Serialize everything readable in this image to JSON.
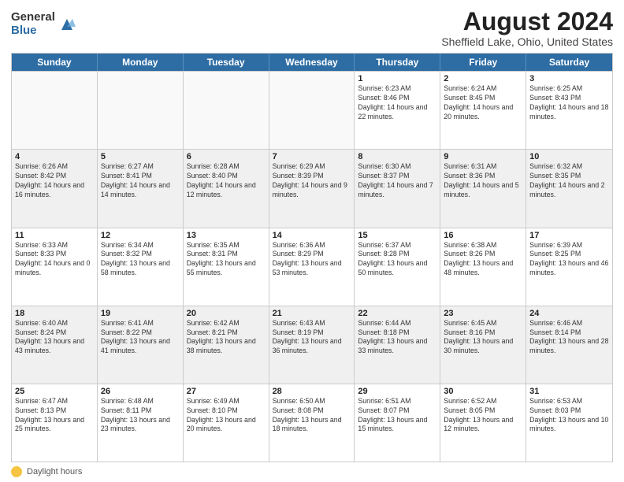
{
  "logo": {
    "general": "General",
    "blue": "Blue"
  },
  "title": "August 2024",
  "location": "Sheffield Lake, Ohio, United States",
  "days_header": [
    "Sunday",
    "Monday",
    "Tuesday",
    "Wednesday",
    "Thursday",
    "Friday",
    "Saturday"
  ],
  "footer": {
    "label": "Daylight hours"
  },
  "weeks": [
    [
      {
        "day": "",
        "sunrise": "",
        "sunset": "",
        "daylight": "",
        "empty": true
      },
      {
        "day": "",
        "sunrise": "",
        "sunset": "",
        "daylight": "",
        "empty": true
      },
      {
        "day": "",
        "sunrise": "",
        "sunset": "",
        "daylight": "",
        "empty": true
      },
      {
        "day": "",
        "sunrise": "",
        "sunset": "",
        "daylight": "",
        "empty": true
      },
      {
        "day": "1",
        "sunrise": "Sunrise: 6:23 AM",
        "sunset": "Sunset: 8:46 PM",
        "daylight": "Daylight: 14 hours and 22 minutes.",
        "empty": false
      },
      {
        "day": "2",
        "sunrise": "Sunrise: 6:24 AM",
        "sunset": "Sunset: 8:45 PM",
        "daylight": "Daylight: 14 hours and 20 minutes.",
        "empty": false
      },
      {
        "day": "3",
        "sunrise": "Sunrise: 6:25 AM",
        "sunset": "Sunset: 8:43 PM",
        "daylight": "Daylight: 14 hours and 18 minutes.",
        "empty": false
      }
    ],
    [
      {
        "day": "4",
        "sunrise": "Sunrise: 6:26 AM",
        "sunset": "Sunset: 8:42 PM",
        "daylight": "Daylight: 14 hours and 16 minutes.",
        "empty": false
      },
      {
        "day": "5",
        "sunrise": "Sunrise: 6:27 AM",
        "sunset": "Sunset: 8:41 PM",
        "daylight": "Daylight: 14 hours and 14 minutes.",
        "empty": false
      },
      {
        "day": "6",
        "sunrise": "Sunrise: 6:28 AM",
        "sunset": "Sunset: 8:40 PM",
        "daylight": "Daylight: 14 hours and 12 minutes.",
        "empty": false
      },
      {
        "day": "7",
        "sunrise": "Sunrise: 6:29 AM",
        "sunset": "Sunset: 8:39 PM",
        "daylight": "Daylight: 14 hours and 9 minutes.",
        "empty": false
      },
      {
        "day": "8",
        "sunrise": "Sunrise: 6:30 AM",
        "sunset": "Sunset: 8:37 PM",
        "daylight": "Daylight: 14 hours and 7 minutes.",
        "empty": false
      },
      {
        "day": "9",
        "sunrise": "Sunrise: 6:31 AM",
        "sunset": "Sunset: 8:36 PM",
        "daylight": "Daylight: 14 hours and 5 minutes.",
        "empty": false
      },
      {
        "day": "10",
        "sunrise": "Sunrise: 6:32 AM",
        "sunset": "Sunset: 8:35 PM",
        "daylight": "Daylight: 14 hours and 2 minutes.",
        "empty": false
      }
    ],
    [
      {
        "day": "11",
        "sunrise": "Sunrise: 6:33 AM",
        "sunset": "Sunset: 8:33 PM",
        "daylight": "Daylight: 14 hours and 0 minutes.",
        "empty": false
      },
      {
        "day": "12",
        "sunrise": "Sunrise: 6:34 AM",
        "sunset": "Sunset: 8:32 PM",
        "daylight": "Daylight: 13 hours and 58 minutes.",
        "empty": false
      },
      {
        "day": "13",
        "sunrise": "Sunrise: 6:35 AM",
        "sunset": "Sunset: 8:31 PM",
        "daylight": "Daylight: 13 hours and 55 minutes.",
        "empty": false
      },
      {
        "day": "14",
        "sunrise": "Sunrise: 6:36 AM",
        "sunset": "Sunset: 8:29 PM",
        "daylight": "Daylight: 13 hours and 53 minutes.",
        "empty": false
      },
      {
        "day": "15",
        "sunrise": "Sunrise: 6:37 AM",
        "sunset": "Sunset: 8:28 PM",
        "daylight": "Daylight: 13 hours and 50 minutes.",
        "empty": false
      },
      {
        "day": "16",
        "sunrise": "Sunrise: 6:38 AM",
        "sunset": "Sunset: 8:26 PM",
        "daylight": "Daylight: 13 hours and 48 minutes.",
        "empty": false
      },
      {
        "day": "17",
        "sunrise": "Sunrise: 6:39 AM",
        "sunset": "Sunset: 8:25 PM",
        "daylight": "Daylight: 13 hours and 46 minutes.",
        "empty": false
      }
    ],
    [
      {
        "day": "18",
        "sunrise": "Sunrise: 6:40 AM",
        "sunset": "Sunset: 8:24 PM",
        "daylight": "Daylight: 13 hours and 43 minutes.",
        "empty": false
      },
      {
        "day": "19",
        "sunrise": "Sunrise: 6:41 AM",
        "sunset": "Sunset: 8:22 PM",
        "daylight": "Daylight: 13 hours and 41 minutes.",
        "empty": false
      },
      {
        "day": "20",
        "sunrise": "Sunrise: 6:42 AM",
        "sunset": "Sunset: 8:21 PM",
        "daylight": "Daylight: 13 hours and 38 minutes.",
        "empty": false
      },
      {
        "day": "21",
        "sunrise": "Sunrise: 6:43 AM",
        "sunset": "Sunset: 8:19 PM",
        "daylight": "Daylight: 13 hours and 36 minutes.",
        "empty": false
      },
      {
        "day": "22",
        "sunrise": "Sunrise: 6:44 AM",
        "sunset": "Sunset: 8:18 PM",
        "daylight": "Daylight: 13 hours and 33 minutes.",
        "empty": false
      },
      {
        "day": "23",
        "sunrise": "Sunrise: 6:45 AM",
        "sunset": "Sunset: 8:16 PM",
        "daylight": "Daylight: 13 hours and 30 minutes.",
        "empty": false
      },
      {
        "day": "24",
        "sunrise": "Sunrise: 6:46 AM",
        "sunset": "Sunset: 8:14 PM",
        "daylight": "Daylight: 13 hours and 28 minutes.",
        "empty": false
      }
    ],
    [
      {
        "day": "25",
        "sunrise": "Sunrise: 6:47 AM",
        "sunset": "Sunset: 8:13 PM",
        "daylight": "Daylight: 13 hours and 25 minutes.",
        "empty": false
      },
      {
        "day": "26",
        "sunrise": "Sunrise: 6:48 AM",
        "sunset": "Sunset: 8:11 PM",
        "daylight": "Daylight: 13 hours and 23 minutes.",
        "empty": false
      },
      {
        "day": "27",
        "sunrise": "Sunrise: 6:49 AM",
        "sunset": "Sunset: 8:10 PM",
        "daylight": "Daylight: 13 hours and 20 minutes.",
        "empty": false
      },
      {
        "day": "28",
        "sunrise": "Sunrise: 6:50 AM",
        "sunset": "Sunset: 8:08 PM",
        "daylight": "Daylight: 13 hours and 18 minutes.",
        "empty": false
      },
      {
        "day": "29",
        "sunrise": "Sunrise: 6:51 AM",
        "sunset": "Sunset: 8:07 PM",
        "daylight": "Daylight: 13 hours and 15 minutes.",
        "empty": false
      },
      {
        "day": "30",
        "sunrise": "Sunrise: 6:52 AM",
        "sunset": "Sunset: 8:05 PM",
        "daylight": "Daylight: 13 hours and 12 minutes.",
        "empty": false
      },
      {
        "day": "31",
        "sunrise": "Sunrise: 6:53 AM",
        "sunset": "Sunset: 8:03 PM",
        "daylight": "Daylight: 13 hours and 10 minutes.",
        "empty": false
      }
    ]
  ]
}
